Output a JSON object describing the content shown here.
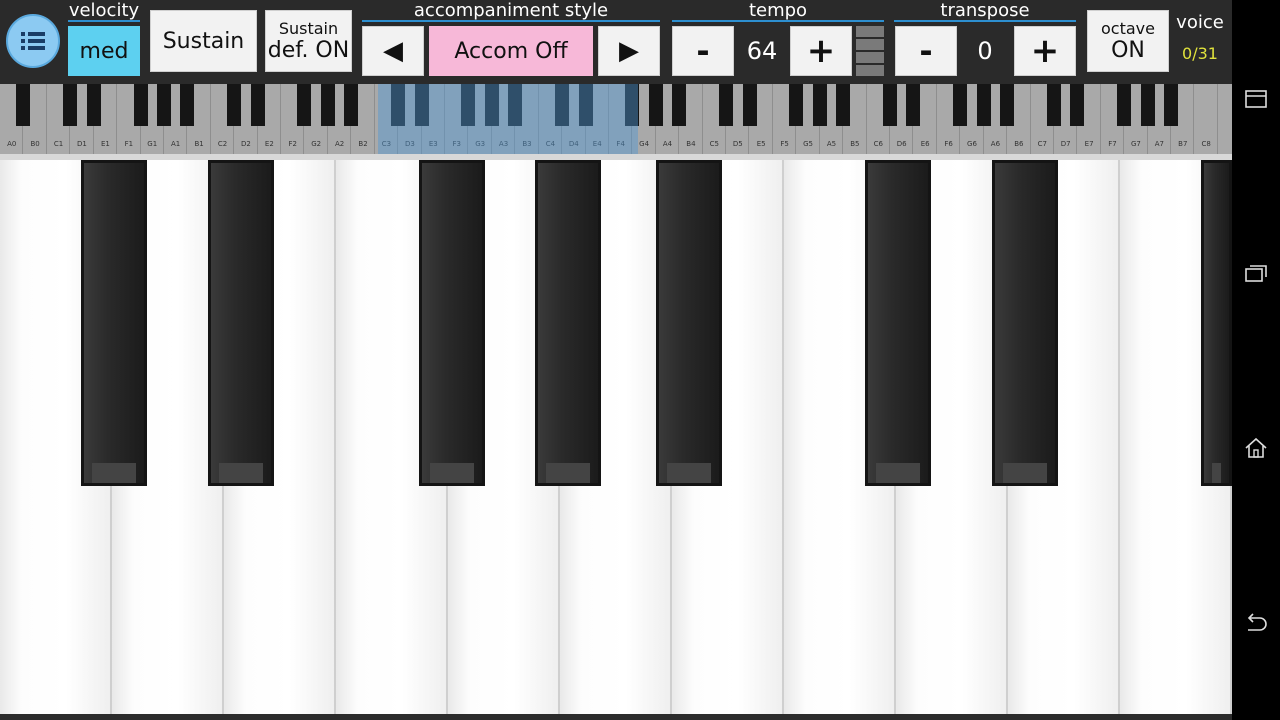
{
  "toolbar": {
    "velocity": {
      "header": "velocity",
      "value": "med"
    },
    "sustain_button": {
      "label": "Sustain"
    },
    "sustain_default": {
      "title": "Sustain",
      "value": "def. ON"
    },
    "accompaniment": {
      "header": "accompaniment style",
      "prev": "◀",
      "value": "Accom Off",
      "next": "▶"
    },
    "tempo": {
      "header": "tempo",
      "minus": "-",
      "value": "64",
      "plus": "+"
    },
    "transpose": {
      "header": "transpose",
      "minus": "-",
      "value": "0",
      "plus": "+"
    },
    "octave": {
      "title": "octave",
      "value": "ON"
    },
    "voice": {
      "header": "voice",
      "count": "0/31"
    }
  },
  "mini_keyboard": {
    "labels": [
      "A0",
      "B0",
      "C1",
      "D1",
      "E1",
      "F1",
      "G1",
      "A1",
      "B1",
      "C2",
      "D2",
      "E2",
      "F2",
      "G2",
      "A2",
      "B2",
      "C3",
      "D3",
      "E3",
      "F3",
      "G3",
      "A3",
      "B3",
      "C4",
      "D4",
      "E4",
      "F4",
      "G4",
      "A4",
      "B4",
      "C5",
      "D5",
      "E5",
      "F5",
      "G5",
      "A5",
      "B5",
      "C6",
      "D6",
      "E6",
      "F6",
      "G6",
      "A6",
      "B6",
      "C7",
      "D7",
      "E7",
      "F7",
      "G7",
      "A7",
      "B7",
      "C8"
    ]
  },
  "colors": {
    "accent": "#2d8fd0",
    "velocity_bg": "#5dd0f0",
    "accom_bg": "#f7b8d8",
    "voice_count": "#e0e23c"
  },
  "icons": {
    "menu": "list-icon",
    "nav": [
      "menu-icon",
      "recent-apps-icon",
      "home-icon",
      "back-icon"
    ]
  }
}
